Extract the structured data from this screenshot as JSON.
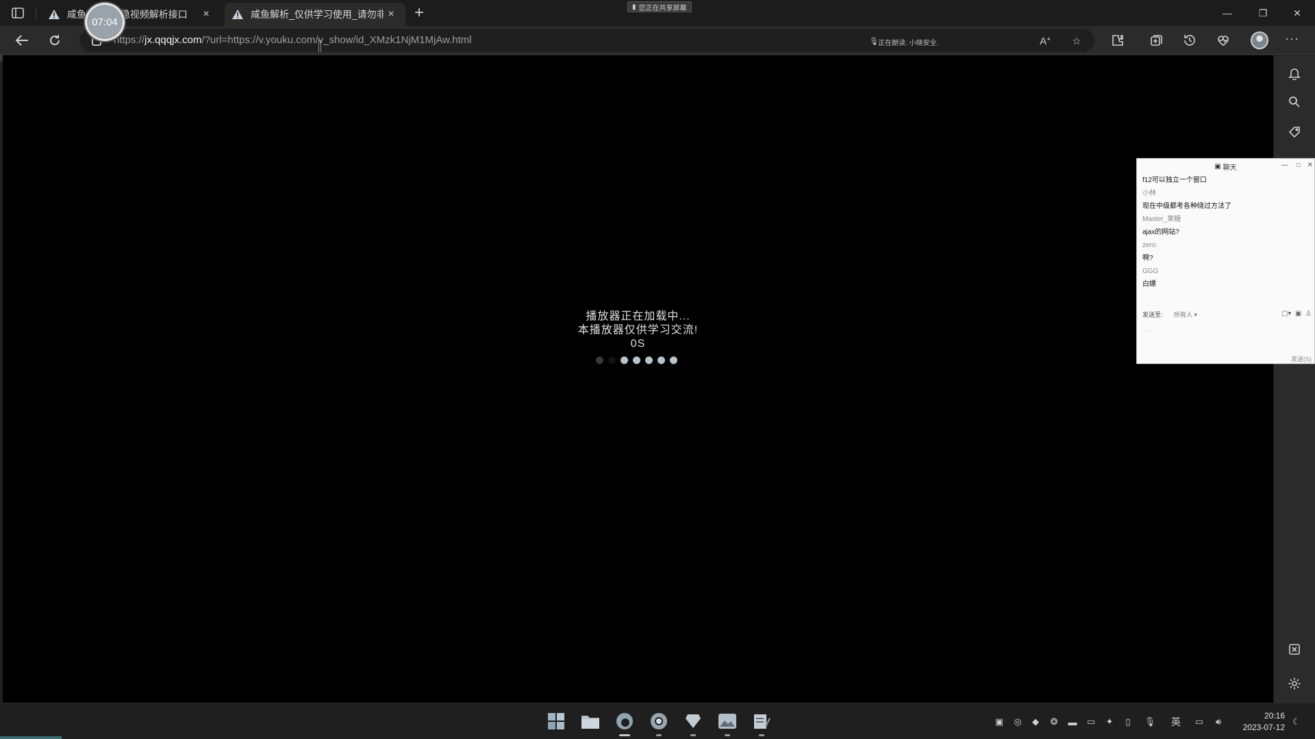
{
  "recorder": {
    "time": "07:04"
  },
  "tabs": [
    {
      "label": "咸鱼解析_最稳视频解析接口",
      "close": "×"
    },
    {
      "label": "咸鱼解析_仅供学习使用_请勿非法",
      "close": "×"
    }
  ],
  "new_tab": "+",
  "share_indicator": "您正在共享屏幕",
  "address": {
    "url_prefix": "https://",
    "url_host": "jx.qqqjx.com",
    "url_rest": "/?url=https://v.youku.com/v_show/id_XMzk1NjM1MjAw.html",
    "reading": "正在朗读: 小晓安全."
  },
  "player": {
    "line1": "播放器正在加载中...",
    "line2": "本播放器仅供学习交流!",
    "counter": "0S"
  },
  "chat": {
    "title": "聊天",
    "messages": [
      {
        "kind": "text",
        "content": "f12可以独立一个窗口"
      },
      {
        "kind": "user",
        "content": "小林"
      },
      {
        "kind": "text",
        "content": "现在中级都考各种绕过方法了"
      },
      {
        "kind": "user",
        "content": "Master_果糖"
      },
      {
        "kind": "text",
        "content": "ajax的网站?"
      },
      {
        "kind": "user",
        "content": "zero."
      },
      {
        "kind": "text",
        "content": "啊?"
      },
      {
        "kind": "user",
        "content": "GGG"
      },
      {
        "kind": "text",
        "content": "白嫖"
      }
    ],
    "send_to_label": "发送至:",
    "send_to_value": "所有人 ▾",
    "input_hint": "...",
    "send_button": "发送(S)"
  },
  "taskbar": {
    "time": "20:16",
    "date": "2023-07-12",
    "ime": "英"
  }
}
